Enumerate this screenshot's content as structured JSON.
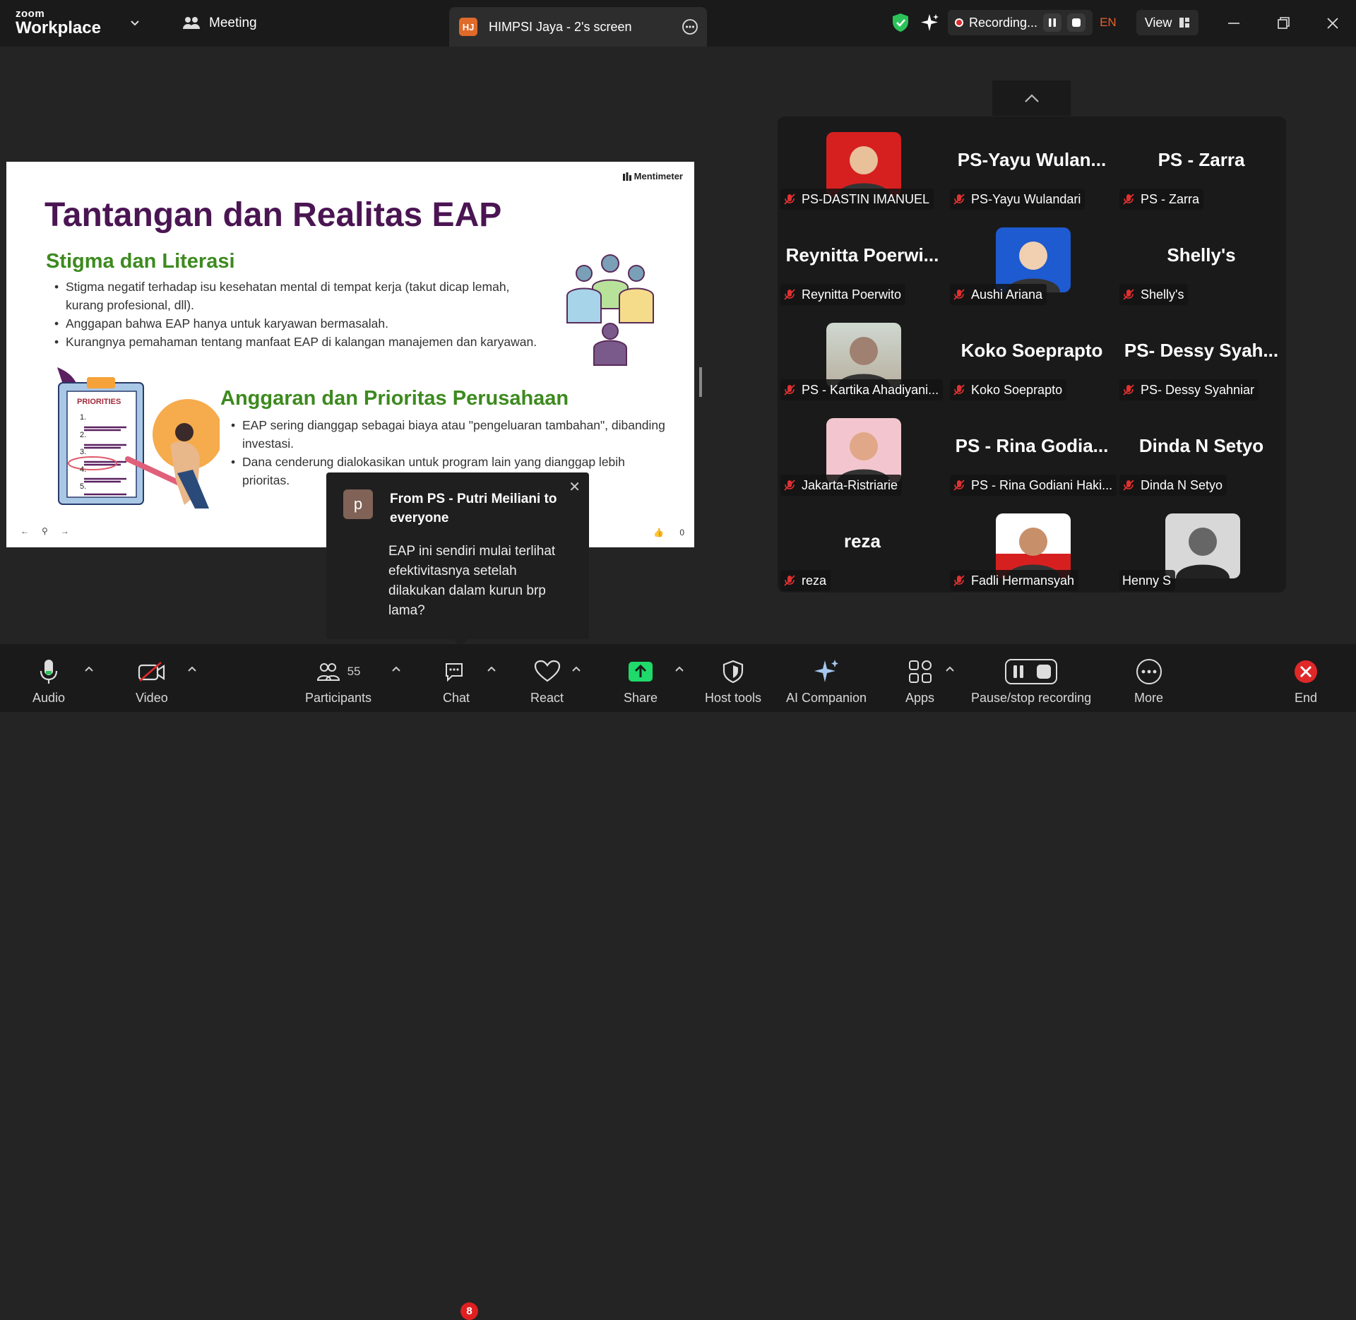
{
  "app": {
    "brand_small": "zoom",
    "brand_big": "Workplace"
  },
  "header": {
    "meeting_label": "Meeting",
    "share_tab": {
      "initials": "HJ",
      "title": "HIMPSI Jaya - 2's screen"
    },
    "recording_label": "Recording...",
    "language": "EN",
    "view_label": "View"
  },
  "slide": {
    "brand": "Mentimeter",
    "title": "Tantangan dan Realitas EAP",
    "section1": {
      "heading": "Stigma dan Literasi",
      "bullets": [
        "Stigma negatif terhadap isu kesehatan mental di tempat kerja (takut dicap lemah, kurang profesional, dll).",
        "Anggapan bahwa EAP hanya untuk karyawan bermasalah.",
        "Kurangnya pemahaman tentang manfaat EAP di kalangan manajemen dan karyawan."
      ]
    },
    "section2": {
      "heading": "Anggaran dan Prioritas Perusahaan",
      "bullets": [
        "EAP sering dianggap sebagai biaya atau \"pengeluaran tambahan\", dibanding investasi.",
        "Dana cenderung dialokasikan untuk program lain yang dianggap lebih prioritas."
      ]
    },
    "clipboard_heading": "PRIORITIES",
    "clipboard_items": [
      "1.",
      "2.",
      "3.",
      "4.",
      "5."
    ],
    "reactions_count": "0"
  },
  "chat_popup": {
    "avatar_letter": "p",
    "from": "From PS - Putri Meiliani to everyone",
    "message": "EAP ini sendiri mulai terlihat efektivitasnya setelah dilakukan dalam kurun brp lama?"
  },
  "participants_tiles": [
    {
      "big": "",
      "label": "PS-DASTIN IMANUEL",
      "photo": "red",
      "muted": true
    },
    {
      "big": "PS-Yayu  Wulan...",
      "label": "PS-Yayu Wulandari",
      "photo": "",
      "muted": true
    },
    {
      "big": "PS - Zarra",
      "label": "PS - Zarra",
      "photo": "",
      "muted": true
    },
    {
      "big": "Reynitta  Poerwi...",
      "label": "Reynitta Poerwito",
      "photo": "",
      "muted": true
    },
    {
      "big": "",
      "label": "Aushi Ariana",
      "photo": "blue",
      "muted": true
    },
    {
      "big": "Shelly's",
      "label": "Shelly's",
      "photo": "",
      "muted": true
    },
    {
      "big": "",
      "label": "PS - Kartika Ahadiyani...",
      "photo": "outdoor",
      "muted": true
    },
    {
      "big": "Koko Soeprapto",
      "label": "Koko Soeprapto",
      "photo": "",
      "muted": true
    },
    {
      "big": "PS-  Dessy  Syah...",
      "label": "PS- Dessy Syahniar",
      "photo": "",
      "muted": true
    },
    {
      "big": "",
      "label": "Jakarta-Ristriarie",
      "photo": "pink",
      "muted": true
    },
    {
      "big": "PS  - Rina Godia...",
      "label": "PS - Rina Godiani Haki...",
      "photo": "",
      "muted": true
    },
    {
      "big": "Dinda N Setyo",
      "label": "Dinda N Setyo",
      "photo": "",
      "muted": true
    },
    {
      "big": "reza",
      "label": "reza",
      "photo": "",
      "muted": true
    },
    {
      "big": "",
      "label": "Fadli Hermansyah",
      "photo": "whitered",
      "muted": true
    },
    {
      "big": "",
      "label": "Henny S",
      "photo": "bw",
      "muted": false
    }
  ],
  "toolbar": {
    "audio": "Audio",
    "video": "Video",
    "participants": "Participants",
    "participants_count": "55",
    "chat": "Chat",
    "chat_badge": "8",
    "react": "React",
    "share": "Share",
    "host_tools": "Host tools",
    "ai_companion": "AI Companion",
    "apps": "Apps",
    "pause_recording": "Pause/stop recording",
    "more": "More",
    "end": "End"
  },
  "colors": {
    "share_green": "#1fd96a",
    "end_red": "#e02828",
    "title_purple": "#4a1552",
    "heading_green": "#3d8a1f"
  }
}
